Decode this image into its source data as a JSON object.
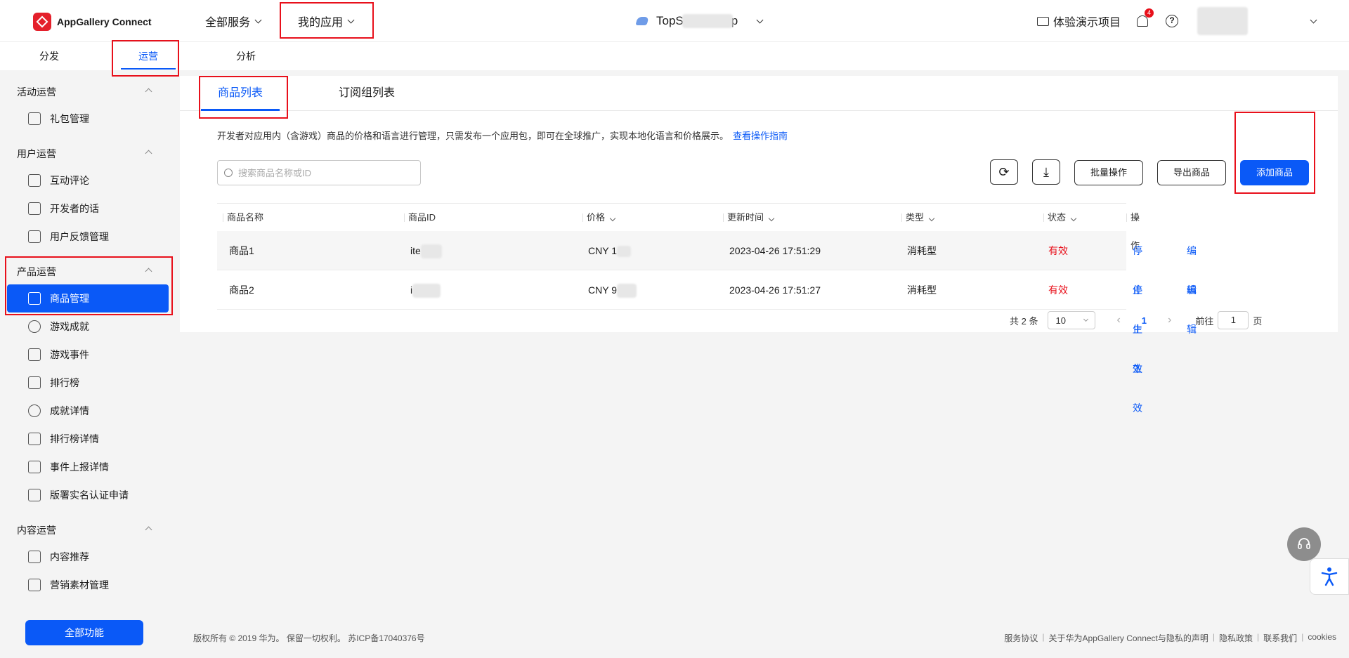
{
  "header": {
    "logo_text": "AppGallery Connect",
    "nav_all_services": "全部服务",
    "nav_my_apps": "我的应用",
    "app_name_prefix": "TopS",
    "app_name_suffix": "p",
    "demo_project": "体验演示项目",
    "notification_count": "4",
    "help_glyph": "?"
  },
  "tabs": {
    "distribute": "分发",
    "operate": "运营",
    "analyze": "分析"
  },
  "sidebar": {
    "groups": {
      "activity": "活动运营",
      "user": "用户运营",
      "product": "产品运营",
      "content": "内容运营"
    },
    "items": {
      "gift": "礼包管理",
      "comments": "互动评论",
      "dev_words": "开发者的话",
      "feedback": "用户反馈管理",
      "products": "商品管理",
      "achievements": "游戏成就",
      "events": "游戏事件",
      "leaderboard": "排行榜",
      "achievement_detail": "成就详情",
      "leaderboard_detail": "排行榜详情",
      "event_detail": "事件上报详情",
      "realname": "版署实名认证申请",
      "recommend": "内容推荐",
      "marketing": "营销素材管理"
    },
    "all_functions": "全部功能"
  },
  "main": {
    "subtabs": {
      "product_list": "商品列表",
      "subscription_groups": "订阅组列表"
    },
    "description": "开发者对应用内（含游戏）商品的价格和语言进行管理，只需发布一个应用包，即可在全球推广，实现本地化语言和价格展示。",
    "guide_link": "查看操作指南",
    "search_placeholder": "搜索商品名称或ID",
    "batch_label": "批量操作",
    "export_label": "导出商品",
    "add_label": "添加商品",
    "columns": {
      "name": "商品名称",
      "id": "商品ID",
      "price": "价格",
      "updated": "更新时间",
      "type": "类型",
      "status": "状态",
      "actions": "操作"
    },
    "rows": [
      {
        "name": "商品1",
        "id": "ite",
        "price": "CNY 1",
        "updated": "2023-04-26 17:51:29",
        "type": "消耗型",
        "status": "有效",
        "stop": "停止生效",
        "edit": "编辑"
      },
      {
        "name": "商品2",
        "id": "i",
        "price": "CNY 9",
        "updated": "2023-04-26 17:51:27",
        "type": "消耗型",
        "status": "有效",
        "stop": "停止生效",
        "edit": "编辑"
      }
    ],
    "pager": {
      "total": "共 2 条",
      "page_size": "10",
      "current_page": "1",
      "goto_label": "前往",
      "goto_value": "1",
      "page_suffix": "页"
    }
  },
  "footer": {
    "copyright": "版权所有 © 2019 华为。 保留一切权利。 苏ICP备17040376号",
    "links": [
      "服务协议",
      "关于华为AppGallery Connect与隐私的声明",
      "隐私政策",
      "联系我们",
      "cookies"
    ]
  },
  "colors": {
    "accent": "#0a59f7",
    "valid_status": "#e8101b",
    "annotation_box": "#e8101b"
  }
}
